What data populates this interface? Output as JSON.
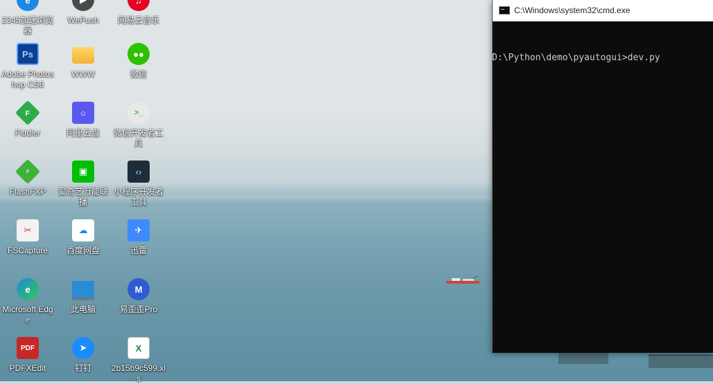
{
  "desktop": {
    "icons": [
      {
        "label": "2345加速浏览器",
        "icon": "browser-2345-icon",
        "color": "#1e88e5"
      },
      {
        "label": "WePush",
        "icon": "wepush-icon",
        "color": "#4a4a4a"
      },
      {
        "label": "网易云音乐",
        "icon": "netease-music-icon",
        "color": "#e60026"
      },
      {
        "label": "Adobe Photoshop CS6",
        "icon": "photoshop-icon",
        "color": "#0b3f8f"
      },
      {
        "label": "WWW",
        "icon": "folder-icon",
        "color": "#f6c343"
      },
      {
        "label": "微信",
        "icon": "wechat-icon",
        "color": "#2dc100"
      },
      {
        "label": "Fiddler",
        "icon": "fiddler-icon",
        "color": "#2eaa4a"
      },
      {
        "label": "阿里云盘",
        "icon": "aliyun-drive-icon",
        "color": "#5b58f0"
      },
      {
        "label": "微信开发者工具",
        "icon": "wechat-devtools-icon",
        "color": "#e9e9e9"
      },
      {
        "label": "FlashFXP",
        "icon": "flashfxp-icon",
        "color": "#3fb13a"
      },
      {
        "label": "爱奇艺万能联播",
        "icon": "iqiyi-icon",
        "color": "#00be06"
      },
      {
        "label": "小程序开发者工具",
        "icon": "miniprogram-devtools-icon",
        "color": "#1f2d3a"
      },
      {
        "label": "FSCapture",
        "icon": "fscapture-icon",
        "color": "#f2f2f2"
      },
      {
        "label": "百度网盘",
        "icon": "baidu-netdisk-icon",
        "color": "#ffffff"
      },
      {
        "label": "迅雷",
        "icon": "xunlei-icon",
        "color": "#3d8bff"
      },
      {
        "label": "Microsoft Edge",
        "icon": "edge-icon",
        "color": "#1b8ad6"
      },
      {
        "label": "此电脑",
        "icon": "this-pc-icon",
        "color": "#2b8cd6"
      },
      {
        "label": "易歪歪Pro",
        "icon": "yiwaiwai-icon",
        "color": "#2f5bd3"
      },
      {
        "label": "PDFXEdit",
        "icon": "pdfxedit-icon",
        "color": "#c62828"
      },
      {
        "label": "钉钉",
        "icon": "dingtalk-icon",
        "color": "#1c8bff"
      },
      {
        "label": "2b15b9c599.xls",
        "icon": "excel-file-icon",
        "color": "#1d7a44"
      }
    ]
  },
  "cmd": {
    "title": "C:\\Windows\\system32\\cmd.exe",
    "prompt_line": "D:\\Python\\demo\\pyautogui>dev.py"
  }
}
